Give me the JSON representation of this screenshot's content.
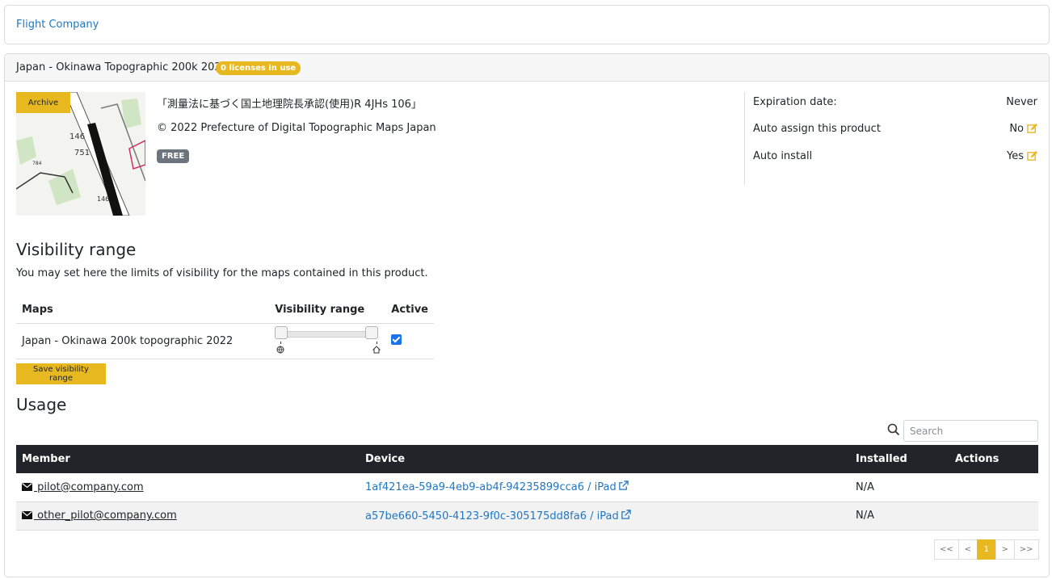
{
  "breadcrumb": {
    "company": "Flight Company"
  },
  "product": {
    "title": "Japan - Okinawa Topographic 200k 2022",
    "licenses_badge": "0 licenses in use",
    "archive_label": "Archive",
    "approval_text": "「測量法に基づく国土地理院長承認(使用)R 4JHs 106」",
    "copyright": "© 2022 Prefecture of Digital Topographic Maps Japan",
    "price_badge": "FREE",
    "meta": [
      {
        "label": "Expiration date:",
        "value": "Never",
        "editable": false
      },
      {
        "label": "Auto assign this product",
        "value": "No",
        "editable": true
      },
      {
        "label": "Auto install",
        "value": "Yes",
        "editable": true
      }
    ]
  },
  "visibility": {
    "heading": "Visibility range",
    "description": "You may set here the limits of visibility for the maps contained in this product.",
    "columns": [
      "Maps",
      "Visibility range",
      "Active"
    ],
    "rows": [
      {
        "map": "Japan - Okinawa 200k topographic 2022",
        "range_min": 0,
        "range_max": 1,
        "active": true
      }
    ],
    "save_label": "Save visibility range"
  },
  "usage": {
    "heading": "Usage",
    "search_placeholder": "Search",
    "columns": [
      "Member",
      "Device",
      "Installed",
      "Actions"
    ],
    "rows": [
      {
        "member": " pilot@company.com",
        "device": "1af421ea-59a9-4eb9-ab4f-94235899cca6 / iPad",
        "installed": "N/A",
        "actions": ""
      },
      {
        "member": " other_pilot@company.com",
        "device": "a57be660-5450-4123-9f0c-305175dd8fa6 / iPad",
        "installed": "N/A",
        "actions": ""
      }
    ],
    "pagination": {
      "first": "<<",
      "prev": "<",
      "current": "1",
      "next": ">",
      "last": ">>"
    }
  },
  "colors": {
    "accent": "#e8b820",
    "link": "#1f77c4",
    "table_header": "#212529",
    "badge_free": "#6c757d"
  }
}
